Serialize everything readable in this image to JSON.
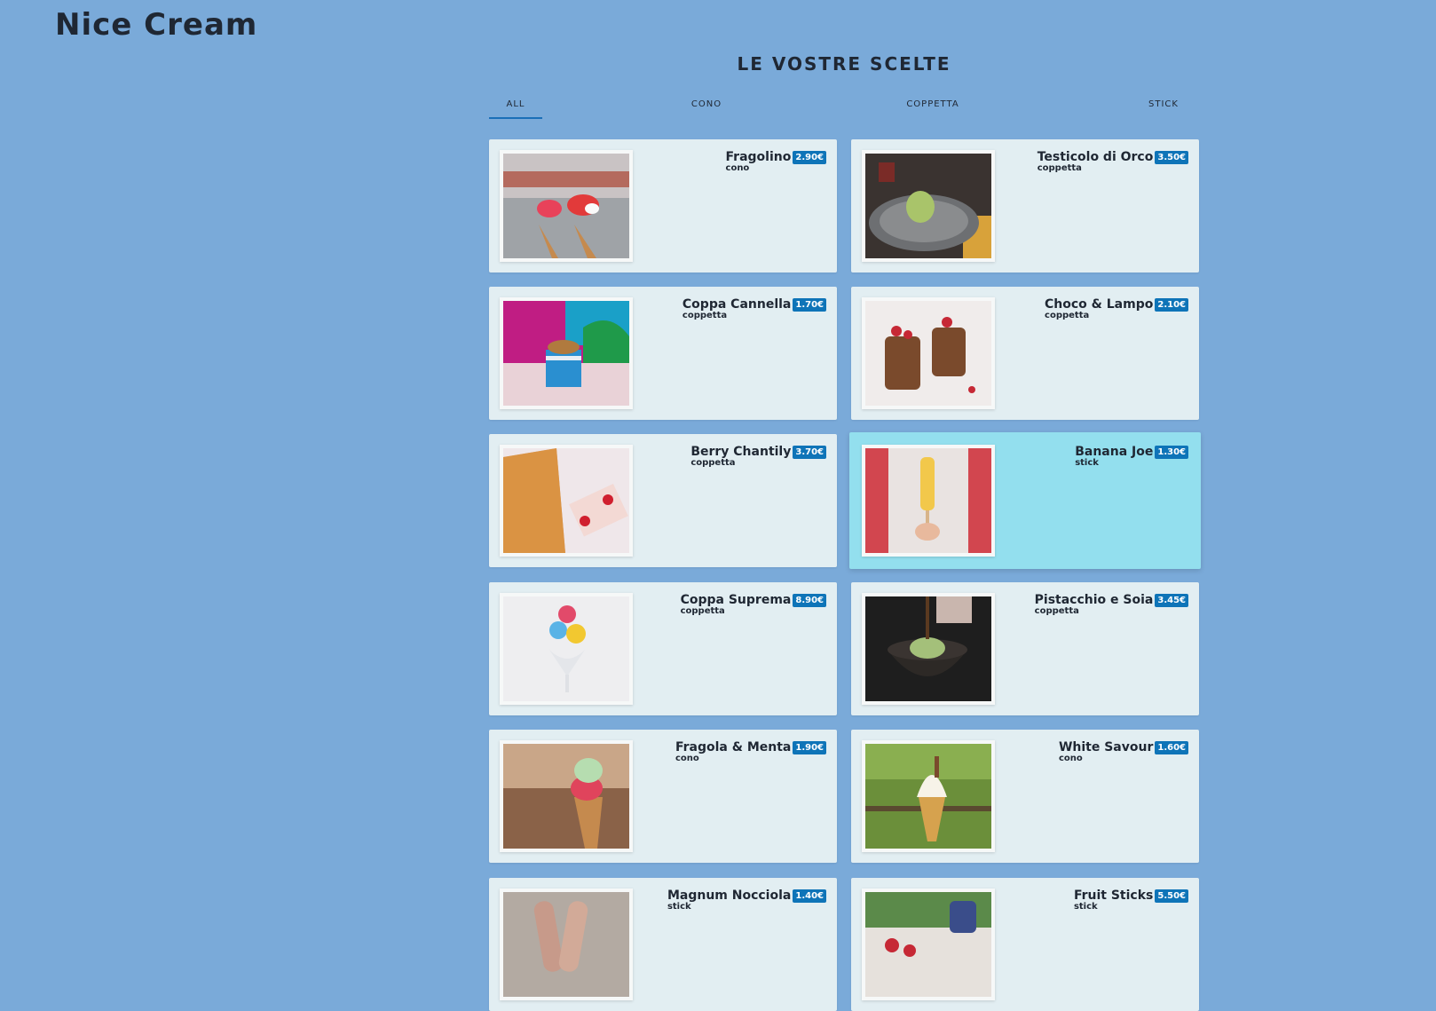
{
  "brand": "Nice Cream",
  "section_title": "LE VOSTRE SCELTE",
  "tabs": [
    "ALL",
    "CONO",
    "COPPETTA",
    "STICK"
  ],
  "active_tab": "ALL",
  "colors": {
    "background": "#7aaad9",
    "card": "#e2eef2",
    "card_highlight": "#93dfee",
    "price_badge": "#0e74b8",
    "tab_underline": "#1a6fb8"
  },
  "products": [
    {
      "name": "Fragolino",
      "price": "2.90€",
      "category": "cono",
      "image": "strawberry-cones-photo"
    },
    {
      "name": "Testicolo di Orco",
      "price": "3.50€",
      "category": "coppetta",
      "image": "green-scoop-plate-photo"
    },
    {
      "name": "Coppa Cannella",
      "price": "1.70€",
      "category": "coppetta",
      "image": "blue-cup-donut-mural-photo"
    },
    {
      "name": "Choco & Lampo",
      "price": "2.10€",
      "category": "coppetta",
      "image": "chocolate-mousse-cups-photo"
    },
    {
      "name": "Berry Chantily",
      "price": "3.70€",
      "category": "coppetta",
      "image": "sprinkle-tray-cherries-photo"
    },
    {
      "name": "Banana Joe",
      "price": "1.30€",
      "category": "stick",
      "image": "girl-popsicle-photo"
    },
    {
      "name": "Coppa Suprema",
      "price": "8.90€",
      "category": "coppetta",
      "image": "colorful-scoops-glass-photo"
    },
    {
      "name": "Pistacchio e Soia",
      "price": "3.45€",
      "category": "coppetta",
      "image": "pistachio-bowl-drizzle-photo"
    },
    {
      "name": "Fragola & Menta",
      "price": "1.90€",
      "category": "cono",
      "image": "mint-strawberry-cone-photo"
    },
    {
      "name": "White Savour",
      "price": "1.60€",
      "category": "cono",
      "image": "soft-serve-cone-grass-photo"
    },
    {
      "name": "Magnum Nocciola",
      "price": "1.40€",
      "category": "stick",
      "image": "chocolate-bars-photo"
    },
    {
      "name": "Fruit Sticks",
      "price": "5.50€",
      "category": "stick",
      "image": "fruit-sticks-picnic-photo"
    }
  ],
  "highlighted_product": "Banana Joe"
}
